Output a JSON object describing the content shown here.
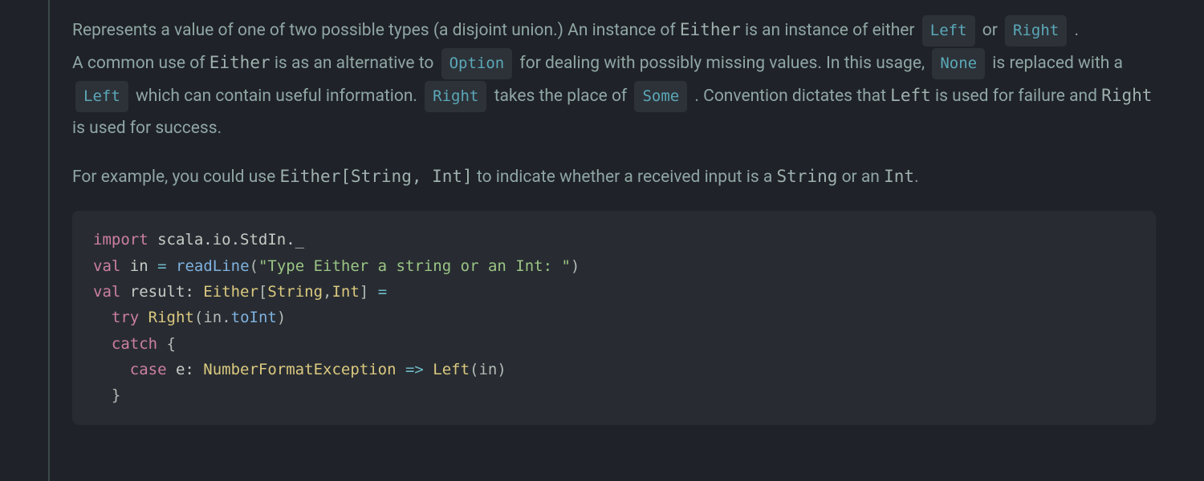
{
  "par1": {
    "t1": "Represents a value of one of two possible types (a disjoint union.) An instance of ",
    "Either": "Either",
    "t2": " is an instance of either ",
    "Left": "Left",
    "t3": " or ",
    "Right": "Right",
    "t4": " ."
  },
  "par2": {
    "t1": "A common use of ",
    "Either": "Either",
    "t2": " is as an alternative to ",
    "Option": "Option",
    "t3": " for dealing with possibly missing values. In this usage, ",
    "None": "None",
    "t4": " is replaced with a ",
    "Left": "Left",
    "t5": " which can contain useful information. ",
    "Right": "Right",
    "t6": " takes the place of ",
    "Some": "Some",
    "t7": " . Convention dictates that ",
    "Left2": "Left",
    "t8": " is used for failure and ",
    "Right2": "Right",
    "t9": " is used for success."
  },
  "par3": {
    "t1": "For example, you could use ",
    "sig": "Either[String, Int]",
    "t2": " to indicate whether a received input is a ",
    "String": "String",
    "t3": " or an ",
    "Int": "Int",
    "t4": "."
  },
  "code": {
    "l1_import": "import",
    "l1_path": " scala.io.StdIn._",
    "l2_val": "val",
    "l2_a": " in ",
    "l2_eq": "=",
    "l2_sp": " ",
    "l2_fn": "readLine",
    "l2_op": "(",
    "l2_str": "\"Type Either a string or an Int: \"",
    "l2_cp": ")",
    "l3_val": "val",
    "l3_a": " result: ",
    "l3_ty1": "Either",
    "l3_ob": "[",
    "l3_ty2": "String",
    "l3_cm": ",",
    "l3_ty3": "Int",
    "l3_cb": "] ",
    "l3_eq": "=",
    "l4_ind": "  ",
    "l4_try": "try",
    "l4_sp": " ",
    "l4_right": "Right",
    "l4_op": "(in.",
    "l4_fn": "toInt",
    "l4_cp": ")",
    "l5_ind": "  ",
    "l5_catch": "catch",
    "l5_brace": " {",
    "l6_ind": "    ",
    "l6_case": "case",
    "l6_a": " e: ",
    "l6_ty": "NumberFormatException",
    "l6_arrow": " => ",
    "l6_left": "Left",
    "l6_args": "(in)",
    "l7_ind": "  ",
    "l7_brace": "}"
  }
}
